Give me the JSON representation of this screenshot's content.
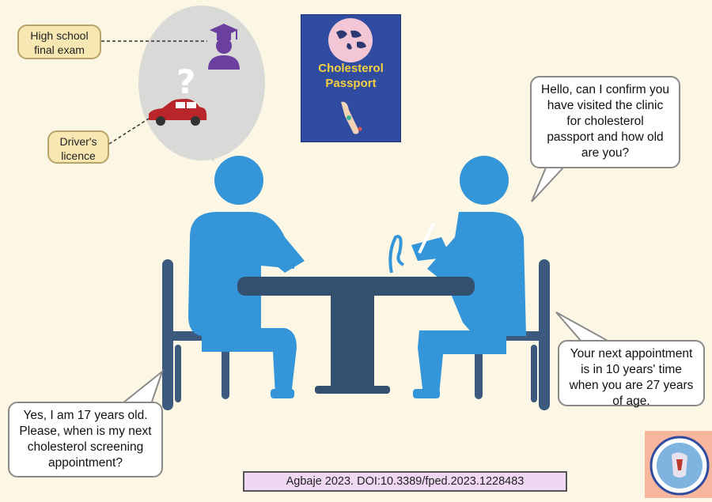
{
  "thought_tags": {
    "exam": "High school\nfinal exam",
    "licence": "Driver's\nlicence"
  },
  "passport": {
    "title": "Cholesterol\nPassport"
  },
  "dialogue": {
    "clinician_question": "Hello, can I confirm you\nhave visited the clinic\nfor cholesterol\npassport and how old\nare you?",
    "patient_answer": "Yes, I am 17 years old.\nPlease, when is my next\ncholesterol screening\nappointment?",
    "clinician_reply": "Your next appointment\nis in 10 years' time\nwhen you are 27 years\nof age."
  },
  "citation": "Agbaje 2023. DOI:10.3389/fped.2023.1228483",
  "colors": {
    "background": "#fbf7e4",
    "figure_blue": "#3496d8",
    "chair_blue": "#3c5a7d",
    "table_blue": "#34506f",
    "thought_cloud": "#d9dad7",
    "passport_blue": "#2f4ca0",
    "passport_title": "#f4d03f",
    "car_red": "#b8262a",
    "graduate_purple": "#6b3fa0",
    "tag_fill": "#f6e7b3",
    "citation_fill": "#f0d7f2"
  },
  "icons": [
    "graduate-icon",
    "question-mark-icon",
    "car-icon",
    "world-map-icon",
    "arm-icon",
    "journal-logo-icon"
  ]
}
